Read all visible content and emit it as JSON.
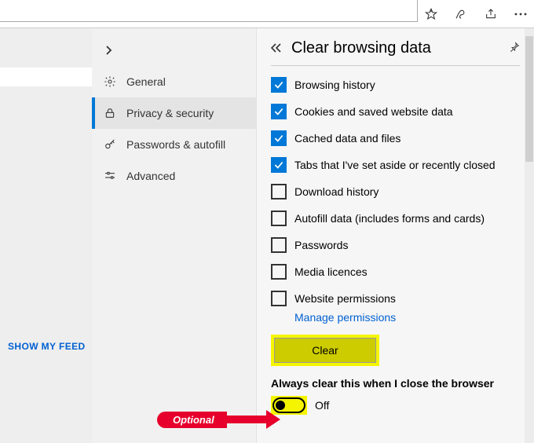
{
  "top_icons": {
    "favorites": "favorites-icon",
    "read": "reading-icon",
    "share": "share-icon",
    "more": "more-icon"
  },
  "left": {
    "show_my_feed": "SHOW MY FEED"
  },
  "sidebar": {
    "items": [
      {
        "id": "general",
        "label": "General"
      },
      {
        "id": "privacy",
        "label": "Privacy & security"
      },
      {
        "id": "passwords",
        "label": "Passwords & autofill"
      },
      {
        "id": "advanced",
        "label": "Advanced"
      }
    ]
  },
  "panel": {
    "title": "Clear browsing data",
    "checkboxes": [
      {
        "label": "Browsing history",
        "checked": true
      },
      {
        "label": "Cookies and saved website data",
        "checked": true
      },
      {
        "label": "Cached data and files",
        "checked": true
      },
      {
        "label": "Tabs that I've set aside or recently closed",
        "checked": true
      },
      {
        "label": "Download history",
        "checked": false
      },
      {
        "label": "Autofill data (includes forms and cards)",
        "checked": false
      },
      {
        "label": "Passwords",
        "checked": false
      },
      {
        "label": "Media licences",
        "checked": false
      },
      {
        "label": "Website permissions",
        "checked": false
      }
    ],
    "manage_permissions": "Manage permissions",
    "clear_button": "Clear",
    "always_clear_title": "Always clear this when I close the browser",
    "toggle_state": "Off"
  },
  "annotation": {
    "optional": "Optional"
  }
}
